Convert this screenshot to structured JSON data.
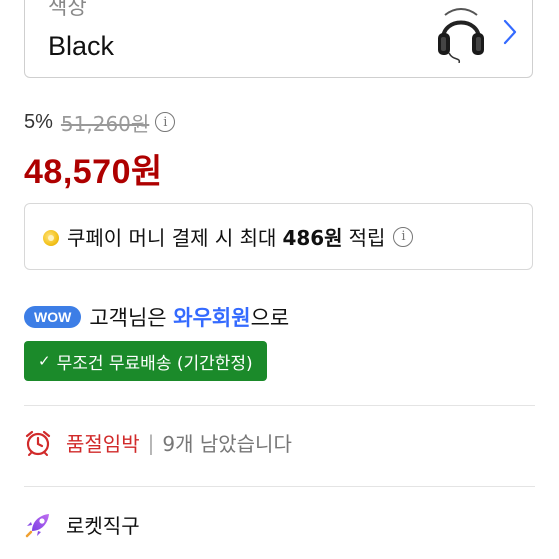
{
  "option": {
    "label": "색상",
    "value": "Black",
    "thumbnail_icon": "headphones-icon",
    "chevron_icon": "chevron-right-icon"
  },
  "price": {
    "discount_rate": "5%",
    "original_price": "51,260원",
    "sale_price": "48,570원",
    "info_icon": "i"
  },
  "cash": {
    "prefix": "쿠페이 머니 결제 시 최대",
    "amount": "486원",
    "suffix": "적립"
  },
  "wow": {
    "badge": "WOW",
    "pre": "고객님은 ",
    "link": "와우회원",
    "post": "으로"
  },
  "shipping": {
    "check": "✓",
    "label": "무조건 무료배송 (기간한정)"
  },
  "stock": {
    "label": "품절임박",
    "separator": "|",
    "count": "9개 남았습니다"
  },
  "delivery": {
    "label": "로켓직구"
  },
  "colors": {
    "sale_price": "#ae0000",
    "wow_badge": "#3d7ee6",
    "wow_link": "#346aff",
    "free_shipping_bg": "#1b8a2a",
    "stock_alert": "#d12a2a"
  }
}
